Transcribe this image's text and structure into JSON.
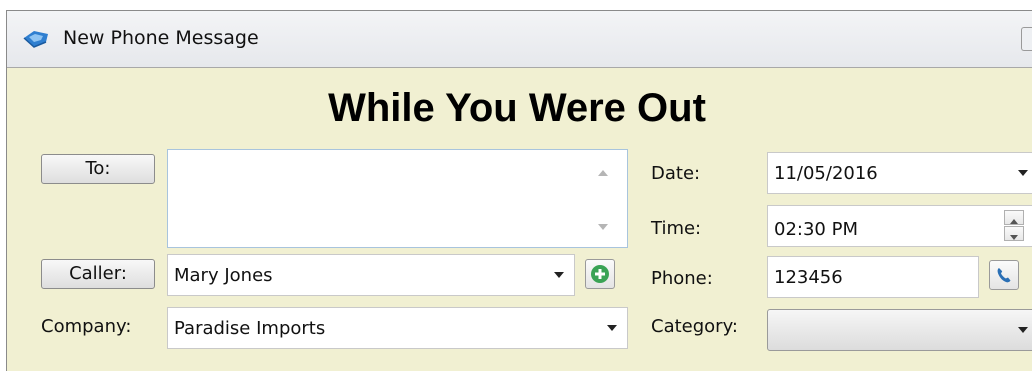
{
  "window": {
    "title": "New Phone Message",
    "icon": "phone-message-icon"
  },
  "form": {
    "heading": "While You Were Out",
    "to": {
      "button_label": "To:",
      "value": ""
    },
    "caller": {
      "button_label": "Caller:",
      "value": "Mary Jones",
      "add_icon": "plus-circle-icon"
    },
    "company": {
      "label": "Company:",
      "value": "Paradise Imports"
    },
    "date": {
      "label": "Date:",
      "value": "11/05/2016"
    },
    "time": {
      "label": "Time:",
      "value": "02:30 PM"
    },
    "phone": {
      "label": "Phone:",
      "value": "123456",
      "dial_icon": "phone-icon"
    },
    "category": {
      "label": "Category:",
      "value": ""
    }
  },
  "colors": {
    "form_background": "#f1f0d2",
    "add_button_green": "#3aa355",
    "dial_button_blue": "#2a6fb5",
    "textarea_border": "#a8c4dd"
  }
}
